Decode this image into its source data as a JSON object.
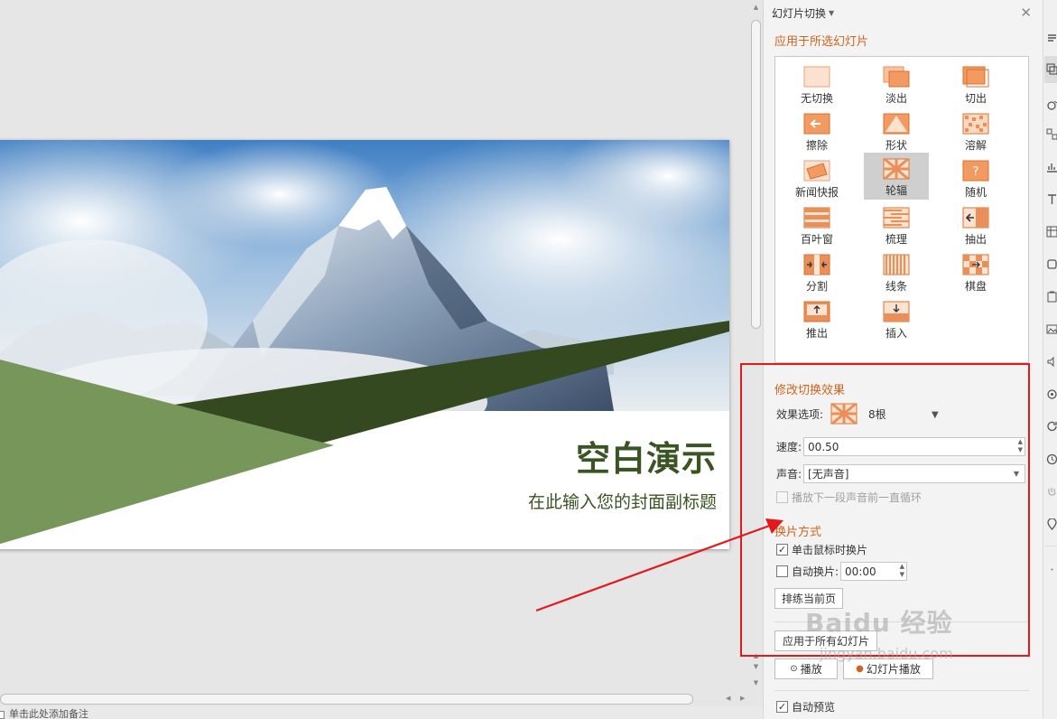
{
  "slide": {
    "title": "空白演示",
    "subtitle": "在此输入您的封面副标题"
  },
  "notes": {
    "placeholder": "单击此处添加备注"
  },
  "pane": {
    "header": "幻灯片切换",
    "apply_section": "应用于所选幻灯片",
    "effects": [
      {
        "label": "无切换",
        "icon": "none-transition-icon"
      },
      {
        "label": "淡出",
        "icon": "fade-icon"
      },
      {
        "label": "切出",
        "icon": "cut-icon"
      },
      {
        "label": "擦除",
        "icon": "wipe-icon"
      },
      {
        "label": "形状",
        "icon": "shape-icon"
      },
      {
        "label": "溶解",
        "icon": "dissolve-icon"
      },
      {
        "label": "新闻快报",
        "icon": "newsflash-icon"
      },
      {
        "label": "轮辐",
        "icon": "wheel-icon"
      },
      {
        "label": "随机",
        "icon": "random-icon"
      },
      {
        "label": "百叶窗",
        "icon": "blinds-icon"
      },
      {
        "label": "梳理",
        "icon": "comb-icon"
      },
      {
        "label": "抽出",
        "icon": "pull-icon"
      },
      {
        "label": "分割",
        "icon": "split-icon"
      },
      {
        "label": "线条",
        "icon": "lines-icon"
      },
      {
        "label": "棋盘",
        "icon": "checkerboard-icon"
      },
      {
        "label": "推出",
        "icon": "push-icon"
      },
      {
        "label": "插入",
        "icon": "insert-icon"
      }
    ],
    "selected_effect": "轮辐",
    "modify_section": "修改切换效果",
    "effect_option_label": "效果选项:",
    "effect_option_value": "8根",
    "speed_label": "速度:",
    "speed_value": "00.50",
    "sound_label": "声音:",
    "sound_value": "[无声音]",
    "loop_label": "播放下一段声音前一直循环",
    "advance_section": "换片方式",
    "on_click_label": "单击鼠标时换片",
    "on_click_checked": true,
    "auto_label": "自动换片:",
    "auto_value": "00:00",
    "rehearse_button": "排练当前页",
    "apply_all_button": "应用于所有幻灯片",
    "play_button": "播放",
    "slideshow_button": "幻灯片播放",
    "autopreview_label": "自动预览",
    "autopreview_checked": true
  },
  "watermark": {
    "text": "Baidu 经验",
    "url": "jingyan.baidu.com"
  },
  "colors": {
    "accent": "#d0641f",
    "slide_green_dark": "#3a5423",
    "slide_green_light": "#77965a",
    "annotation_red": "#e3191b"
  }
}
